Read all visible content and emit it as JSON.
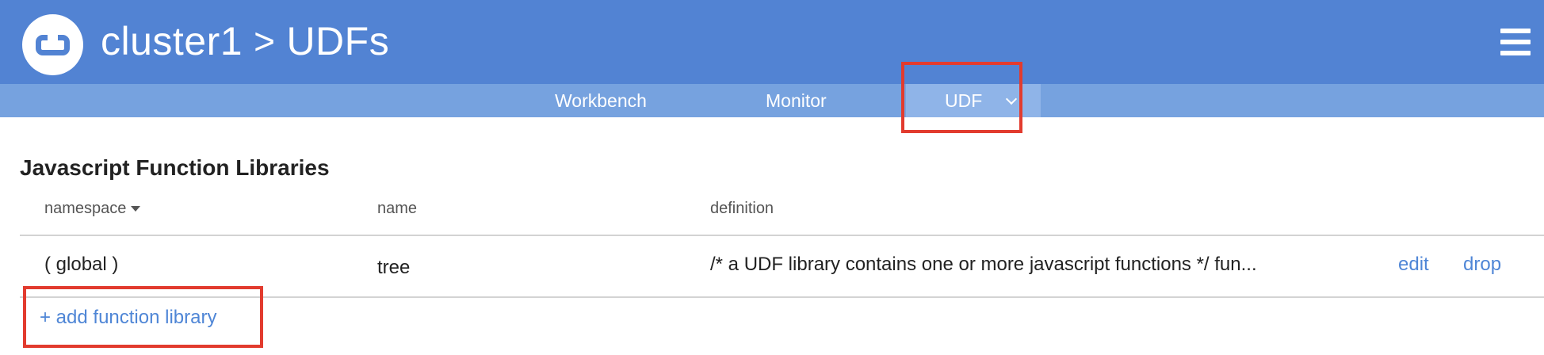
{
  "header": {
    "logo_icon": "couchbase-logo-icon",
    "cluster_name": "cluster1",
    "separator": ">",
    "page_name": "UDFs",
    "menu_icon": "hamburger-menu-icon",
    "bar_color": "#5283d3"
  },
  "subnav": {
    "tabs": [
      {
        "label": "Workbench"
      },
      {
        "label": "Monitor"
      },
      {
        "label": "UDF",
        "active": true,
        "has_dropdown": true
      }
    ],
    "bar_color": "#76a2df"
  },
  "section": {
    "title": "Javascript Function Libraries"
  },
  "table": {
    "columns": [
      {
        "label": "namespace",
        "sortable": true
      },
      {
        "label": "name"
      },
      {
        "label": "definition"
      }
    ],
    "rows": [
      {
        "namespace": "( global )",
        "name": "tree",
        "definition": "/* a UDF library contains one or more javascript functions */ fun...",
        "edit_label": "edit",
        "drop_label": "drop"
      }
    ]
  },
  "actions": {
    "add_library_label": "+ add function library",
    "link_color": "#4f86d6"
  },
  "annotation_color": "#e23b2e"
}
